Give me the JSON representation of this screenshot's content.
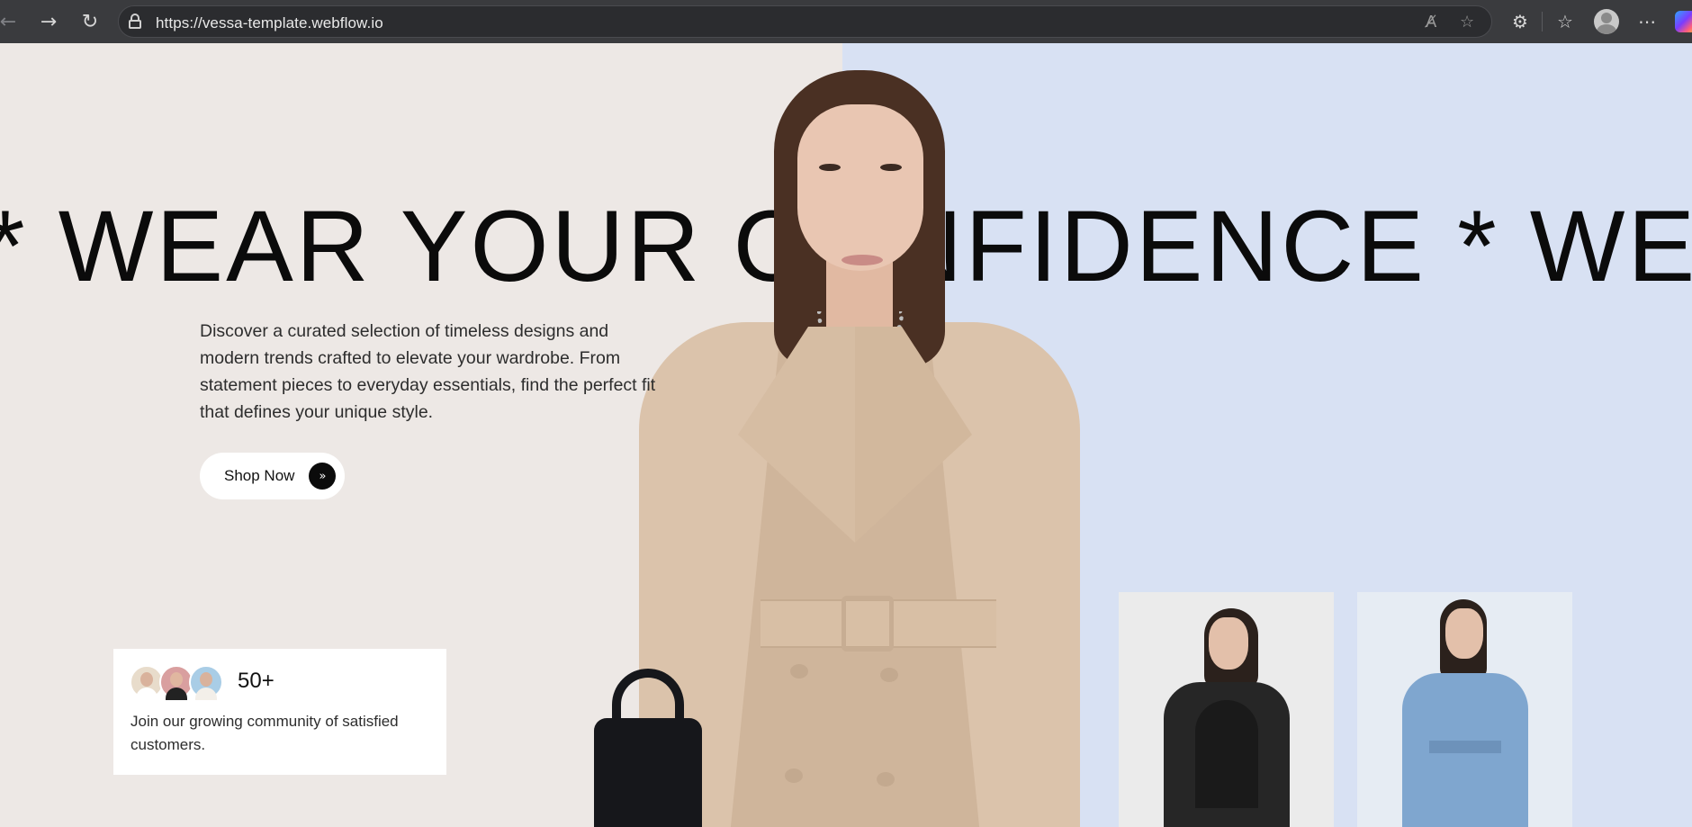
{
  "browser": {
    "url": "https://vessa-template.webflow.io",
    "icons": [
      "back-arrow-icon",
      "forward-arrow-icon",
      "reload-icon",
      "lock-icon",
      "read-aloud-icon",
      "favorite-star-icon",
      "extensions-icon",
      "favorites-icon",
      "profile-icon",
      "more-icon",
      "copilot-icon"
    ]
  },
  "hero": {
    "marquee": "* WEAR YOUR CONFIDENCE * WEAR YOUR CONFIDENCE",
    "description": "Discover a curated selection of timeless designs and modern trends crafted to elevate your wardrobe. From statement pieces to everyday essentials, find the perfect fit that defines your unique style.",
    "cta_label": "Shop Now",
    "cta_icon": "»"
  },
  "community": {
    "count": "50+",
    "text": "Join our growing community of satisfied customers."
  },
  "colors": {
    "left_bg": "#ede8e5",
    "right_bg": "#d8e1f3",
    "text": "#0b0b0b",
    "coat": "#dbc3ab"
  }
}
